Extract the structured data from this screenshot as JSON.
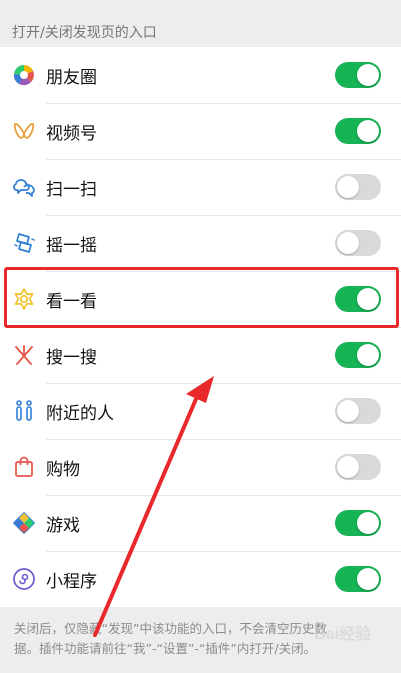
{
  "section": {
    "title": "打开/关闭发现页的入口"
  },
  "items": [
    {
      "label": "朋友圈",
      "icon": "moments-icon",
      "on": true
    },
    {
      "label": "视频号",
      "icon": "channels-icon",
      "on": true
    },
    {
      "label": "扫一扫",
      "icon": "scan-icon",
      "on": false
    },
    {
      "label": "摇一摇",
      "icon": "shake-icon",
      "on": false
    },
    {
      "label": "看一看",
      "icon": "top-stories-icon",
      "on": true
    },
    {
      "label": "搜一搜",
      "icon": "search-icon",
      "on": true
    },
    {
      "label": "附近的人",
      "icon": "people-nearby-icon",
      "on": false
    },
    {
      "label": "购物",
      "icon": "shopping-bag-icon",
      "on": false
    },
    {
      "label": "游戏",
      "icon": "games-icon",
      "on": true
    },
    {
      "label": "小程序",
      "icon": "mini-programs-icon",
      "on": true
    }
  ],
  "footer": {
    "line1": "关闭后，仅隐藏“发现”中该功能的入口，不会清空历史数",
    "line2": "据。插件功能请前往“我”-“设置”-“插件”内打开/关闭。"
  },
  "colors": {
    "toggle_on": "#16b455",
    "toggle_off": "#d9d9d9",
    "highlight": "#e8282b"
  },
  "watermark": "Bai经验"
}
